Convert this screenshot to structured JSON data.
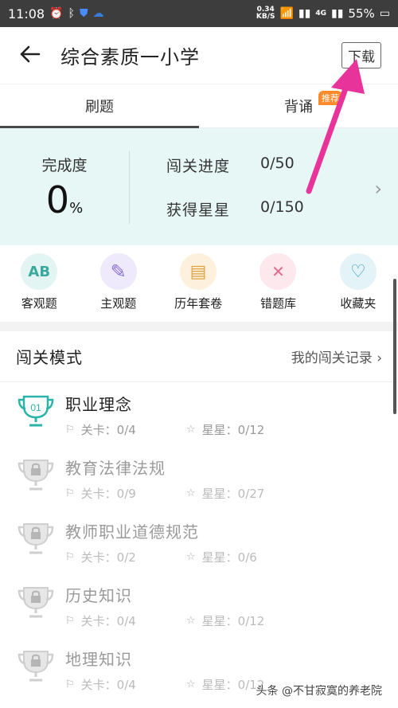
{
  "status_bar": {
    "time": "11:08",
    "net_speed": "0.34",
    "net_unit": "KB/S",
    "network": "4G",
    "battery": "55%"
  },
  "header": {
    "title": "综合素质一小学",
    "download_label": "下载"
  },
  "tabs": [
    {
      "label": "刷题"
    },
    {
      "label": "背诵"
    }
  ],
  "tab_badge": "推荐",
  "progress": {
    "completion_label": "完成度",
    "completion_value": "0",
    "completion_unit": "%",
    "level_progress_label": "闯关进度",
    "level_progress_value": "0/50",
    "stars_label": "获得星星",
    "stars_value": "0/150"
  },
  "menu": [
    {
      "label": "客观题",
      "icon": "ab-icon",
      "glyph": "AB"
    },
    {
      "label": "主观题",
      "icon": "pencil-icon",
      "glyph": "✎"
    },
    {
      "label": "历年套卷",
      "icon": "folder-icon",
      "glyph": "▤"
    },
    {
      "label": "错题库",
      "icon": "wrong-icon",
      "glyph": "✕"
    },
    {
      "label": "收藏夹",
      "icon": "heart-folder-icon",
      "glyph": "♡"
    }
  ],
  "section": {
    "title": "闯关模式",
    "record_link": "我的闯关记录"
  },
  "levels": [
    {
      "name": "职业理念",
      "badge": "01",
      "stages": "关卡：0/4",
      "stars": "星星：0/12",
      "locked": false
    },
    {
      "name": "教育法律法规",
      "stages": "关卡：0/9",
      "stars": "星星：0/27",
      "locked": true
    },
    {
      "name": "教师职业道德规范",
      "stages": "关卡：0/2",
      "stars": "星星：0/6",
      "locked": true
    },
    {
      "name": "历史知识",
      "stages": "关卡：0/4",
      "stars": "星星：0/12",
      "locked": true
    },
    {
      "name": "地理知识",
      "stages": "关卡：0/4",
      "stars": "星星：0/12",
      "locked": true
    }
  ],
  "watermark": "头条 @不甘寂寞的养老院",
  "colors": {
    "accent_arrow": "#e8339a",
    "progress_bg": "#e7f7f5",
    "trophy_active": "#2ab3a8",
    "badge_orange": "#ff8a2b"
  }
}
